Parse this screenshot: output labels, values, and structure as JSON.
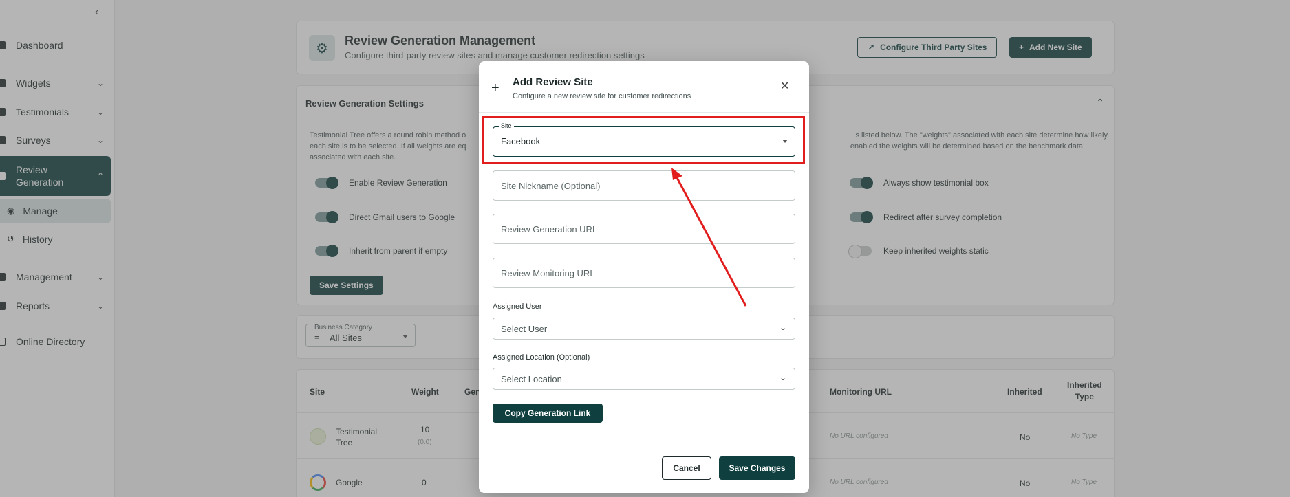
{
  "sidebar": {
    "items": [
      {
        "label": "Dashboard"
      },
      {
        "label": "Widgets"
      },
      {
        "label": "Testimonials"
      },
      {
        "label": "Surveys"
      },
      {
        "label": "Review Generation"
      },
      {
        "label": "Management"
      },
      {
        "label": "Reports"
      },
      {
        "label": "Online Directory"
      }
    ],
    "sub_items": [
      {
        "label": "Manage"
      },
      {
        "label": "History"
      }
    ]
  },
  "header": {
    "title": "Review Generation Management",
    "subtitle": "Configure third-party review sites and manage customer redirection settings",
    "configure_label": "Configure Third Party Sites",
    "add_label": "Add New Site"
  },
  "settings": {
    "title": "Review Generation Settings",
    "desc_left": "Testimonial Tree offers a round robin method o",
    "desc_left2": "each site is to be selected. If all weights are eq",
    "desc_left3": "associated with each site.",
    "desc_right": "s listed below. The \"weights\" associated with each site determine how likely",
    "desc_right2": "enabled the weights will be determined based on the benchmark data",
    "toggles": [
      {
        "label": "Enable Review Generation"
      },
      {
        "label": "Direct Gmail users to Google"
      },
      {
        "label": "Inherit from parent if empty"
      },
      {
        "label": "Always show testimonial box"
      },
      {
        "label": "Redirect after survey completion"
      },
      {
        "label": "Keep inherited weights static"
      }
    ],
    "save_label": "Save Settings"
  },
  "filter": {
    "label": "Business Category",
    "value": "All Sites"
  },
  "table": {
    "headers": {
      "site": "Site",
      "weight": "Weight",
      "gen": "Gen",
      "monitoring": "Monitoring URL",
      "inherited": "Inherited",
      "inherited_type_1": "Inherited",
      "inherited_type_2": "Type"
    },
    "rows": [
      {
        "site_1": "Testimonial",
        "site_2": "Tree",
        "weight": "10",
        "weight_sub": "(0.0)",
        "monitoring": "No URL configured",
        "inherited": "No",
        "type": "No Type"
      },
      {
        "site_1": "Google",
        "weight": "0",
        "monitoring": "No URL configured",
        "inherited": "No",
        "type": "No Type"
      }
    ]
  },
  "modal": {
    "title": "Add Review Site",
    "subtitle": "Configure a new review site for customer redirections",
    "site_label": "Site",
    "site_value": "Facebook",
    "nickname_placeholder": "Site Nickname (Optional)",
    "gen_url_placeholder": "Review Generation URL",
    "mon_url_placeholder": "Review Monitoring URL",
    "user_label": "Assigned User",
    "user_value": "Select User",
    "location_label": "Assigned Location (Optional)",
    "location_value": "Select Location",
    "copy_label": "Copy Generation Link",
    "cancel_label": "Cancel",
    "save_label": "Save Changes"
  },
  "colors": {
    "accent": "#0f3f3f",
    "highlight": "#e11d1d"
  }
}
